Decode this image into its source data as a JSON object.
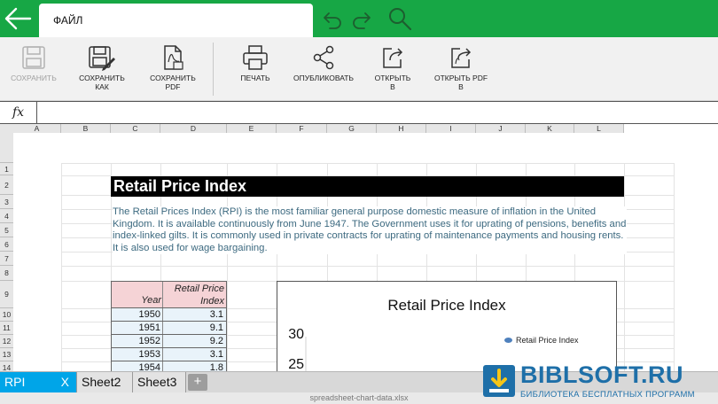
{
  "topbar": {
    "tab_label": "ФАЙЛ"
  },
  "ribbon": {
    "items": [
      {
        "label": "СОХРАНИТЬ",
        "icon": "save-icon"
      },
      {
        "label": "СОХРАНИТЬ\nКАК",
        "icon": "save-as-icon"
      },
      {
        "label": "СОХРАНИТЬ\nPDF",
        "icon": "save-pdf-icon"
      },
      {
        "label": "ПЕЧАТЬ",
        "icon": "printer-icon"
      },
      {
        "label": "ОПУБЛИКОВАТЬ",
        "icon": "share-icon"
      },
      {
        "label": "ОТКРЫТЬ\nВ",
        "icon": "open-in-icon"
      },
      {
        "label": "ОТКРЫТЬ PDF\nВ",
        "icon": "open-pdf-in-icon"
      }
    ]
  },
  "formula": {
    "fx_label": "fx",
    "value": ""
  },
  "columns": [
    "A",
    "B",
    "C",
    "D",
    "E",
    "F",
    "G",
    "H",
    "I",
    "J",
    "K",
    "L"
  ],
  "rows": [
    "1",
    "2",
    "3",
    "4",
    "5",
    "6",
    "7",
    "8",
    "9",
    "10",
    "11",
    "12",
    "13",
    "14"
  ],
  "sheet": {
    "title": "Retail Price Index",
    "description": "The Retail Prices Index (RPI) is the most familiar general purpose domestic measure of inflation in the United Kingdom. It is available continuously from June 1947. The Government uses it for uprating of pensions, benefits and index-linked gilts. It is commonly used in private contracts for uprating of maintenance payments and housing rents. It is also used for wage bargaining.",
    "table": {
      "header_year": "Year",
      "header_index": "Retail Price Index",
      "rows": [
        {
          "year": "1950",
          "value": "3.1"
        },
        {
          "year": "1951",
          "value": "9.1"
        },
        {
          "year": "1952",
          "value": "9.2"
        },
        {
          "year": "1953",
          "value": "3.1"
        },
        {
          "year": "1954",
          "value": "1.8"
        }
      ]
    }
  },
  "chart_data": {
    "type": "line",
    "title": "Retail Price Index",
    "legend": [
      "Retail Price Index"
    ],
    "legend_position": "top-right",
    "y_ticks_visible": [
      "30",
      "25"
    ],
    "series_color": "#4f81bd"
  },
  "tabs": {
    "sheets": [
      {
        "label": "RPI",
        "active": true,
        "close": "X"
      },
      {
        "label": "Sheet2",
        "active": false
      },
      {
        "label": "Sheet3",
        "active": false
      }
    ],
    "add_label": "+"
  },
  "filename": "spreadsheet-chart-data.xlsx",
  "watermark": {
    "name": "BIBLSOFT.RU",
    "tagline": "БИБЛИОТЕКА БЕСПЛАТНЫХ ПРОГРАММ"
  },
  "colors": {
    "topbar": "#17a745",
    "active_tab": "#00a5e8",
    "table_header": "#f5d3d6",
    "table_body": "#e9f3fa",
    "description_text": "#3d6a80"
  }
}
